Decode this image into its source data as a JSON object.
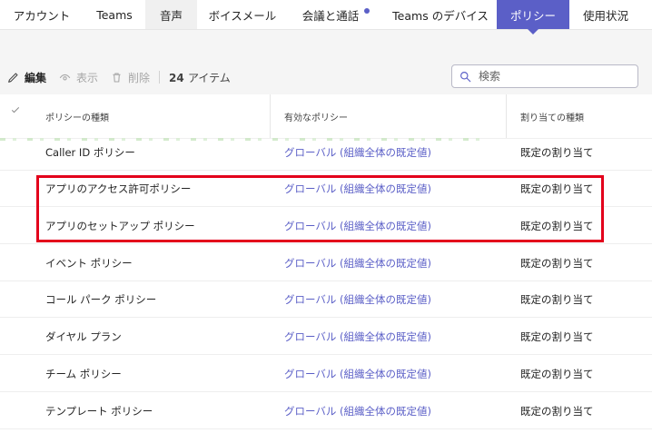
{
  "tabs": [
    {
      "label": "アカウント"
    },
    {
      "label": "Teams"
    },
    {
      "label": "音声"
    },
    {
      "label": "ボイスメール"
    },
    {
      "label": "会議と通話"
    },
    {
      "label": "Teams のデバイス"
    },
    {
      "label": "ポリシー"
    },
    {
      "label": "使用状況"
    }
  ],
  "toolbar": {
    "edit_label": "編集",
    "view_label": "表示",
    "delete_label": "削除",
    "count": "24",
    "count_label": "アイテム",
    "search_placeholder": "検索"
  },
  "table": {
    "headers": [
      "ポリシーの種類",
      "有効なポリシー",
      "割り当ての種類"
    ],
    "rows": [
      {
        "name": "Caller ID ポリシー",
        "policy": "グローバル (組織全体の既定値)",
        "type": "既定の割り当て"
      },
      {
        "name": "アプリのアクセス許可ポリシー",
        "policy": "グローバル (組織全体の既定値)",
        "type": "既定の割り当て"
      },
      {
        "name": "アプリのセットアップ ポリシー",
        "policy": "グローバル (組織全体の既定値)",
        "type": "既定の割り当て"
      },
      {
        "name": "イベント ポリシー",
        "policy": "グローバル (組織全体の既定値)",
        "type": "既定の割り当て"
      },
      {
        "name": "コール パーク ポリシー",
        "policy": "グローバル (組織全体の既定値)",
        "type": "既定の割り当て"
      },
      {
        "name": "ダイヤル プラン",
        "policy": "グローバル (組織全体の既定値)",
        "type": "既定の割り当て"
      },
      {
        "name": "チーム ポリシー",
        "policy": "グローバル (組織全体の既定値)",
        "type": "既定の割り当て"
      },
      {
        "name": "テンプレート ポリシー",
        "policy": "グローバル (組織全体の既定値)",
        "type": "既定の割り当て"
      }
    ]
  },
  "colors": {
    "accent": "#5b5fc7",
    "highlight": "#e3001b"
  },
  "icons": [
    "pencil-icon",
    "eye-icon",
    "trash-icon",
    "search-icon",
    "checkmark-icon"
  ]
}
